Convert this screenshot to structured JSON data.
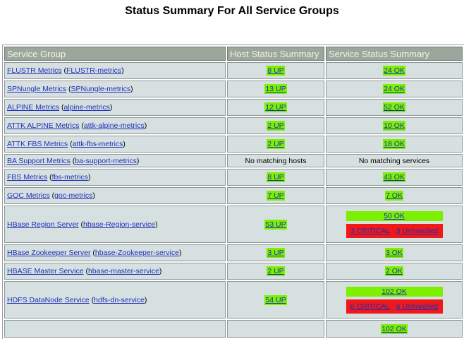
{
  "page": {
    "title": "Status Summary For All Service Groups"
  },
  "table": {
    "headers": [
      "Service Group",
      "Host Status Summary",
      "Service Status Summary"
    ],
    "rows": [
      {
        "name": "FLUSTR Metrics",
        "alias": "FLUSTR-metrics",
        "host": "8 UP",
        "service": "24 OK"
      },
      {
        "name": "SPNungle Metrics",
        "alias": "SPNungle-metrics",
        "host": "13 UP",
        "service": "24 OK"
      },
      {
        "name": "ALPINE Metrics",
        "alias": "alpine-metrics",
        "host": "12 UP",
        "service": "52 OK"
      },
      {
        "name": "ATTK ALPINE Metrics",
        "alias": "attk-alpine-metrics",
        "host": "2 UP",
        "service": "10 OK"
      },
      {
        "name": "ATTK FBS Metrics",
        "alias": "attk-fbs-metrics",
        "host": "2 UP",
        "service": "18 OK"
      },
      {
        "name": "BA Support Metrics",
        "alias": "ba-support-metrics",
        "host": "No matching hosts",
        "service": "No matching services"
      },
      {
        "name": "FBS Metrics",
        "alias": "fbs-metrics",
        "host": "8 UP",
        "service": "43 OK"
      },
      {
        "name": "GOC Metrics",
        "alias": "goc-metrics",
        "host": "7 UP",
        "service": "7 OK"
      },
      {
        "name": "HBase Region Server",
        "alias": "hbase-Region-service",
        "host": "53 UP",
        "service": "50 OK",
        "critical": "3 CRITICAL",
        "unhandled": "3 Unhandled"
      },
      {
        "name": "HBase Zookeeper Server",
        "alias": "hbase-Zookeeper-service",
        "host": "3 UP",
        "service": "3 OK"
      },
      {
        "name": "HBASE Master Service",
        "alias": "hbase-master-service",
        "host": "2 UP",
        "service": "2 OK"
      },
      {
        "name": "HDFS DataNode Service",
        "alias": "hdfs-dn-service",
        "host": "54 UP",
        "service": "102 OK",
        "critical": "6 CRITICAL",
        "unhandled": "6 Unhandled"
      },
      {
        "service": "102 OK"
      }
    ]
  },
  "colors": {
    "ok": "#7cf000",
    "critical": "#f01818",
    "header": "#9ba69c",
    "cell": "#d7e0e0",
    "link": "#1d30b8"
  }
}
